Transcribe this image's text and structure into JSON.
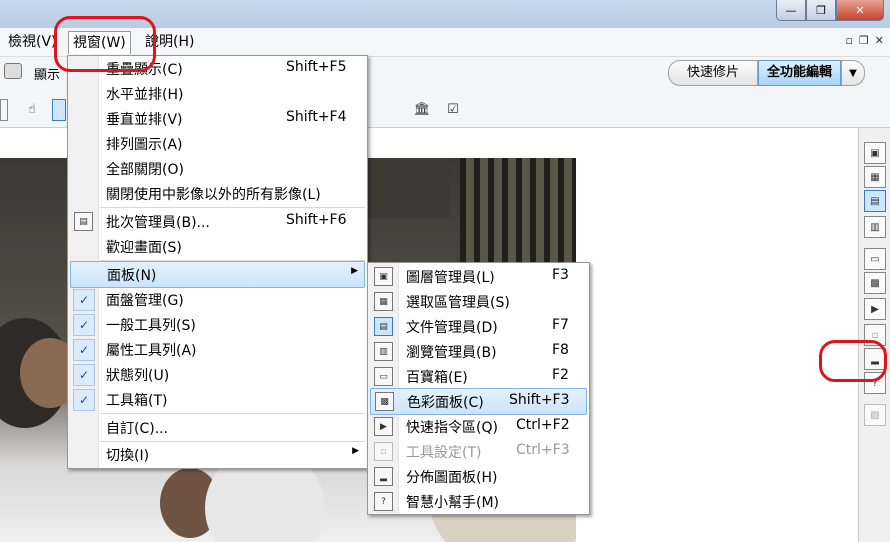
{
  "window": {
    "minimize_symbol": "—",
    "restore_symbol": "❐",
    "close_symbol": "✕"
  },
  "menubar": {
    "items": [
      "檢視(V)",
      "視窗(W)",
      "說明(H)"
    ],
    "mdi_restore": "▫",
    "mdi_max": "❐",
    "mdi_close": "✕"
  },
  "toolbar": {
    "display_label": "顯示",
    "quick_fix": "快速修片",
    "full_edit": "全功能編輯",
    "dropdown_symbol": "▼"
  },
  "window_menu": {
    "items": [
      {
        "label": "重疊顯示(C)",
        "shortcut": "Shift+F5"
      },
      {
        "label": "水平並排(H)",
        "shortcut": ""
      },
      {
        "label": "垂直並排(V)",
        "shortcut": "Shift+F4"
      },
      {
        "label": "排列圖示(A)",
        "shortcut": ""
      },
      {
        "label": "全部關閉(O)",
        "shortcut": ""
      },
      {
        "label": "關閉使用中影像以外的所有影像(L)",
        "shortcut": ""
      },
      {
        "label": "批次管理員(B)...",
        "shortcut": "Shift+F6"
      },
      {
        "label": "歡迎畫面(S)",
        "shortcut": ""
      },
      {
        "label": "面板(N)",
        "shortcut": ""
      },
      {
        "label": "面盤管理(G)",
        "shortcut": ""
      },
      {
        "label": "一般工具列(S)",
        "shortcut": ""
      },
      {
        "label": "屬性工具列(A)",
        "shortcut": ""
      },
      {
        "label": "狀態列(U)",
        "shortcut": ""
      },
      {
        "label": "工具箱(T)",
        "shortcut": ""
      },
      {
        "label": "自訂(C)...",
        "shortcut": ""
      },
      {
        "label": "切換(I)",
        "shortcut": ""
      }
    ],
    "check_symbol": "✓",
    "submenu_arrow": "▶"
  },
  "panel_submenu": {
    "items": [
      {
        "label": "圖層管理員(L)",
        "shortcut": "F3",
        "enabled": true
      },
      {
        "label": "選取區管理員(S)",
        "shortcut": "",
        "enabled": true
      },
      {
        "label": "文件管理員(D)",
        "shortcut": "F7",
        "enabled": true
      },
      {
        "label": "瀏覽管理員(B)",
        "shortcut": "F8",
        "enabled": true
      },
      {
        "label": "百寶箱(E)",
        "shortcut": "F2",
        "enabled": true
      },
      {
        "label": "色彩面板(C)",
        "shortcut": "Shift+F3",
        "enabled": true
      },
      {
        "label": "快速指令區(Q)",
        "shortcut": "Ctrl+F2",
        "enabled": true
      },
      {
        "label": "工具設定(T)",
        "shortcut": "Ctrl+F3",
        "enabled": false
      },
      {
        "label": "分佈圖面板(H)",
        "shortcut": "",
        "enabled": true
      },
      {
        "label": "智慧小幫手(M)",
        "shortcut": "",
        "enabled": true
      }
    ]
  },
  "colors": {
    "highlight_border": "#84b2e3",
    "annotation": "#e0141e"
  }
}
